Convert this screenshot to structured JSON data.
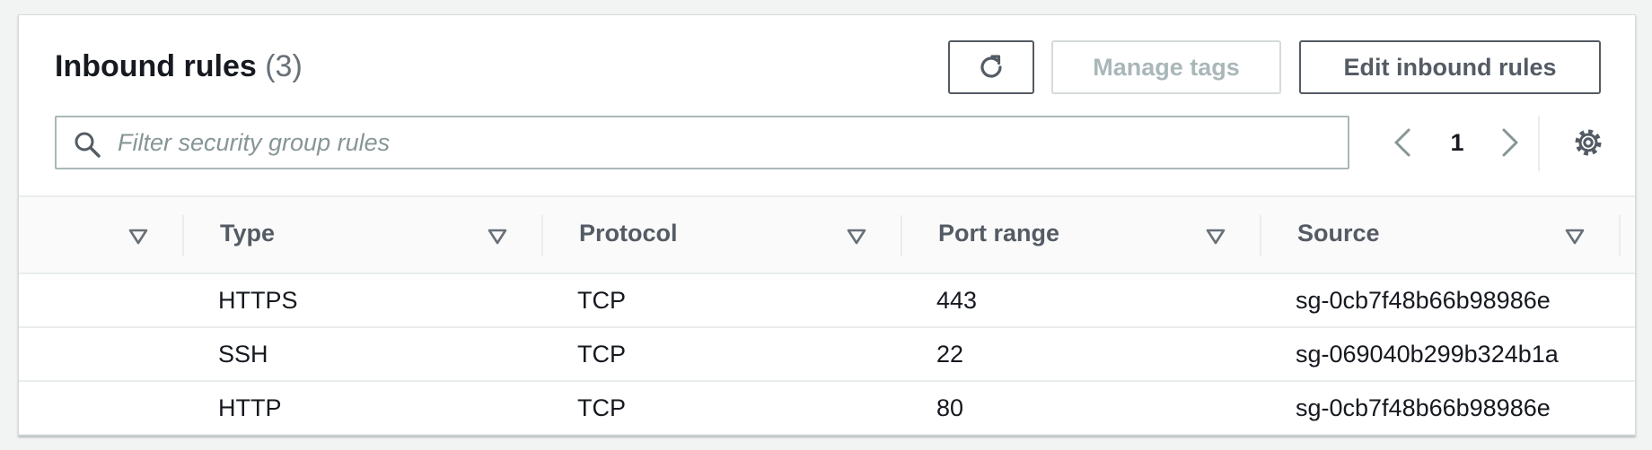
{
  "header": {
    "title": "Inbound rules",
    "count": "(3)"
  },
  "toolbar": {
    "refresh_icon": "refresh-icon",
    "manage_tags_label": "Manage tags",
    "manage_tags_disabled": true,
    "edit_inbound_rules_label": "Edit inbound rules"
  },
  "search": {
    "placeholder": "Filter security group rules",
    "value": "",
    "icon": "search-icon"
  },
  "pagination": {
    "current_page": "1",
    "prev_icon": "chevron-left-icon",
    "next_icon": "chevron-right-icon"
  },
  "preferences_icon": "gear-icon",
  "table": {
    "columns": [
      {
        "label": ""
      },
      {
        "label": "Type"
      },
      {
        "label": "Protocol"
      },
      {
        "label": "Port range"
      },
      {
        "label": "Source"
      }
    ],
    "rows": [
      {
        "type": "HTTPS",
        "protocol": "TCP",
        "port_range": "443",
        "source": "sg-0cb7f48b66b98986e"
      },
      {
        "type": "SSH",
        "protocol": "TCP",
        "port_range": "22",
        "source": "sg-069040b299b324b1a"
      },
      {
        "type": "HTTP",
        "protocol": "TCP",
        "port_range": "80",
        "source": "sg-0cb7f48b66b98986e"
      }
    ]
  },
  "colors": {
    "page_background": "#f2f3f3",
    "text_primary": "#16191f",
    "text_secondary": "#545b64",
    "text_disabled": "#aab7b8",
    "border": "#eaeded"
  }
}
